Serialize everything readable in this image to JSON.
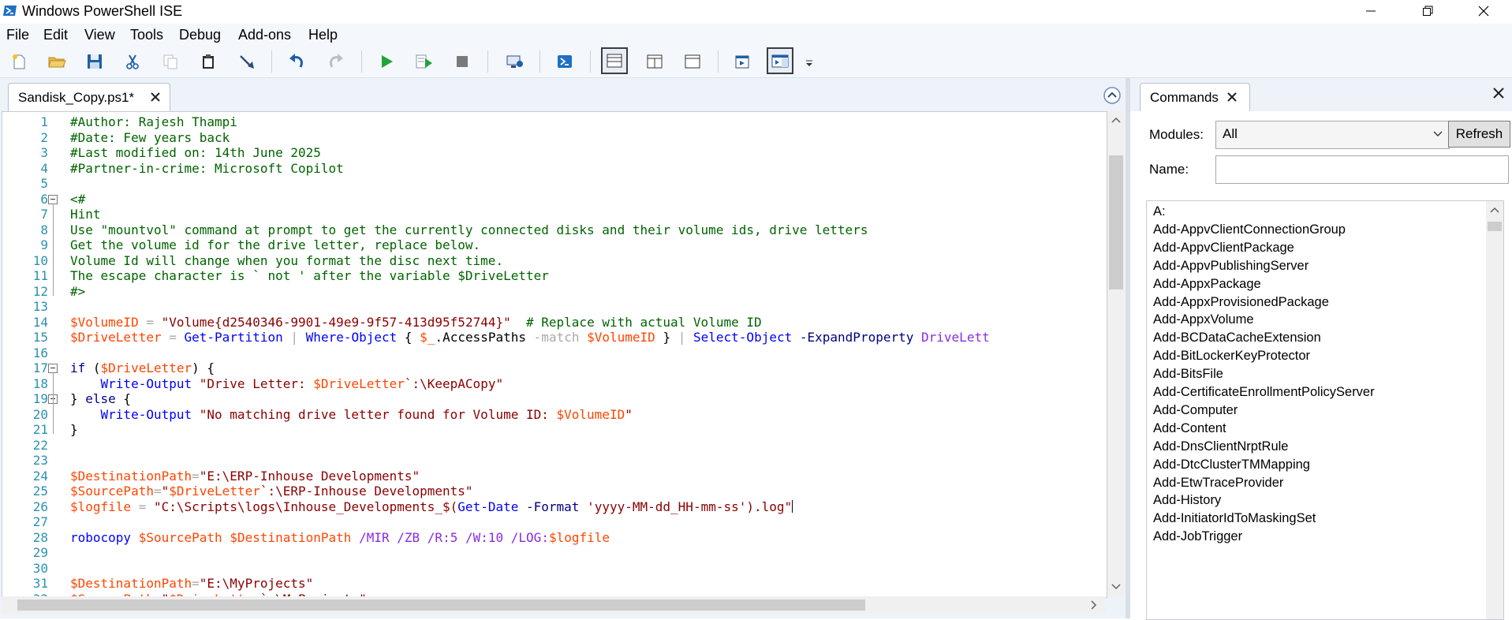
{
  "window": {
    "title": "Windows PowerShell ISE"
  },
  "menu": [
    "File",
    "Edit",
    "View",
    "Tools",
    "Debug",
    "Add-ons",
    "Help"
  ],
  "toolbar": {
    "buttons": [
      "new-script",
      "open",
      "save",
      "cut",
      "copy",
      "paste",
      "clear-console",
      "undo",
      "redo",
      "run-script",
      "run-selection",
      "stop",
      "new-remote-powershell-tab",
      "start-powershell-exe",
      "show-script-pane-top",
      "show-script-pane-right",
      "show-script-pane-maximized",
      "show-script-pane",
      "show-commands-addon",
      "toolbar-overflow"
    ]
  },
  "editor": {
    "tab_label": "Sandisk_Copy.ps1*",
    "lines": [
      [
        {
          "t": "#Author: Rajesh Thampi",
          "c": "com"
        }
      ],
      [
        {
          "t": "#Date: Few years back",
          "c": "com"
        }
      ],
      [
        {
          "t": "#Last modified on: 14th June 2025",
          "c": "com"
        }
      ],
      [
        {
          "t": "#Partner-in-crime: Microsoft Copilot",
          "c": "com"
        }
      ],
      [],
      [
        {
          "t": "<#",
          "c": "com"
        }
      ],
      [
        {
          "t": "Hint",
          "c": "com"
        }
      ],
      [
        {
          "t": "Use \"mountvol\" command at prompt to get the currently connected disks and their volume ids, drive letters",
          "c": "com"
        }
      ],
      [
        {
          "t": "Get the volume id for the drive letter, replace below.",
          "c": "com"
        }
      ],
      [
        {
          "t": "Volume Id will change when you format the disc next time.",
          "c": "com"
        }
      ],
      [
        {
          "t": "The escape character is ` not ' after the variable $DriveLetter",
          "c": "com"
        }
      ],
      [
        {
          "t": "#>",
          "c": "com"
        }
      ],
      [],
      [
        {
          "t": "$VolumeID",
          "c": "var"
        },
        {
          "t": " ",
          "c": "txt"
        },
        {
          "t": "=",
          "c": "op"
        },
        {
          "t": " ",
          "c": "txt"
        },
        {
          "t": "\"Volume{d2540346-9901-49e9-9f57-413d95f52744}\"",
          "c": "str"
        },
        {
          "t": "  ",
          "c": "txt"
        },
        {
          "t": "# Replace with actual Volume ID",
          "c": "com"
        }
      ],
      [
        {
          "t": "$DriveLetter",
          "c": "var"
        },
        {
          "t": " ",
          "c": "txt"
        },
        {
          "t": "=",
          "c": "op"
        },
        {
          "t": " ",
          "c": "txt"
        },
        {
          "t": "Get-Partition",
          "c": "cmd"
        },
        {
          "t": " ",
          "c": "txt"
        },
        {
          "t": "|",
          "c": "op"
        },
        {
          "t": " ",
          "c": "txt"
        },
        {
          "t": "Where-Object",
          "c": "cmd"
        },
        {
          "t": " { ",
          "c": "txt"
        },
        {
          "t": "$_",
          "c": "var"
        },
        {
          "t": ".AccessPaths ",
          "c": "mem"
        },
        {
          "t": "-match",
          "c": "op"
        },
        {
          "t": " ",
          "c": "txt"
        },
        {
          "t": "$VolumeID",
          "c": "var"
        },
        {
          "t": " } ",
          "c": "txt"
        },
        {
          "t": "|",
          "c": "op"
        },
        {
          "t": " ",
          "c": "txt"
        },
        {
          "t": "Select-Object",
          "c": "cmd"
        },
        {
          "t": " ",
          "c": "txt"
        },
        {
          "t": "-ExpandProperty",
          "c": "prm"
        },
        {
          "t": " ",
          "c": "txt"
        },
        {
          "t": "DriveLett",
          "c": "par"
        }
      ],
      [],
      [
        {
          "t": "if",
          "c": "kw"
        },
        {
          "t": " (",
          "c": "txt"
        },
        {
          "t": "$DriveLetter",
          "c": "var"
        },
        {
          "t": ") {",
          "c": "txt"
        }
      ],
      [
        {
          "t": "    ",
          "c": "txt"
        },
        {
          "t": "Write-Output",
          "c": "cmd"
        },
        {
          "t": " ",
          "c": "txt"
        },
        {
          "t": "\"Drive Letter: ",
          "c": "str"
        },
        {
          "t": "$DriveLetter",
          "c": "var"
        },
        {
          "t": "`:\\KeepACopy\"",
          "c": "str"
        }
      ],
      [
        {
          "t": "} ",
          "c": "txt"
        },
        {
          "t": "else",
          "c": "kw"
        },
        {
          "t": " {",
          "c": "txt"
        }
      ],
      [
        {
          "t": "    ",
          "c": "txt"
        },
        {
          "t": "Write-Output",
          "c": "cmd"
        },
        {
          "t": " ",
          "c": "txt"
        },
        {
          "t": "\"No matching drive letter found for Volume ID: ",
          "c": "str"
        },
        {
          "t": "$VolumeID",
          "c": "var"
        },
        {
          "t": "\"",
          "c": "str"
        }
      ],
      [
        {
          "t": "}",
          "c": "txt"
        }
      ],
      [],
      [],
      [
        {
          "t": "$DestinationPath",
          "c": "var"
        },
        {
          "t": "=",
          "c": "op"
        },
        {
          "t": "\"E:\\ERP-Inhouse Developments\"",
          "c": "str"
        }
      ],
      [
        {
          "t": "$SourcePath",
          "c": "var"
        },
        {
          "t": "=",
          "c": "op"
        },
        {
          "t": "\"",
          "c": "str"
        },
        {
          "t": "$DriveLetter",
          "c": "var"
        },
        {
          "t": "`:\\ERP-Inhouse Developments\"",
          "c": "str"
        }
      ],
      [
        {
          "t": "$logfile",
          "c": "var"
        },
        {
          "t": " ",
          "c": "txt"
        },
        {
          "t": "=",
          "c": "op"
        },
        {
          "t": " ",
          "c": "txt"
        },
        {
          "t": "\"C:\\Scripts\\logs\\Inhouse_Developments_$(",
          "c": "str"
        },
        {
          "t": "Get-Date",
          "c": "cmd"
        },
        {
          "t": " ",
          "c": "txt"
        },
        {
          "t": "-Format",
          "c": "prm"
        },
        {
          "t": " ",
          "c": "txt"
        },
        {
          "t": "'yyyy-MM-dd_HH-mm-ss'",
          "c": "str"
        },
        {
          "t": ").log\"",
          "c": "str"
        }
      ],
      [],
      [
        {
          "t": "robocopy",
          "c": "cmd"
        },
        {
          "t": " ",
          "c": "txt"
        },
        {
          "t": "$SourcePath",
          "c": "var"
        },
        {
          "t": " ",
          "c": "txt"
        },
        {
          "t": "$DestinationPath",
          "c": "var"
        },
        {
          "t": " ",
          "c": "txt"
        },
        {
          "t": "/MIR",
          "c": "par"
        },
        {
          "t": " ",
          "c": "txt"
        },
        {
          "t": "/ZB",
          "c": "par"
        },
        {
          "t": " ",
          "c": "txt"
        },
        {
          "t": "/R:5",
          "c": "par"
        },
        {
          "t": " ",
          "c": "txt"
        },
        {
          "t": "/W:10",
          "c": "par"
        },
        {
          "t": " ",
          "c": "txt"
        },
        {
          "t": "/LOG:",
          "c": "par"
        },
        {
          "t": "$logfile",
          "c": "var"
        }
      ],
      [],
      [],
      [
        {
          "t": "$DestinationPath",
          "c": "var"
        },
        {
          "t": "=",
          "c": "op"
        },
        {
          "t": "\"E:\\MyProjects\"",
          "c": "str"
        }
      ],
      [
        {
          "t": "$SourcePath",
          "c": "var"
        },
        {
          "t": "=",
          "c": "op"
        },
        {
          "t": "\"",
          "c": "str"
        },
        {
          "t": "$DriveLetter",
          "c": "var"
        },
        {
          "t": "`:\\MyProjects\"",
          "c": "str"
        }
      ]
    ],
    "caret_line": 26
  },
  "commands": {
    "tab_label": "Commands",
    "modules_label": "Modules:",
    "modules_value": "All",
    "refresh_label": "Refresh",
    "name_label": "Name:",
    "name_value": "",
    "items": [
      "A:",
      "Add-AppvClientConnectionGroup",
      "Add-AppvClientPackage",
      "Add-AppvPublishingServer",
      "Add-AppxPackage",
      "Add-AppxProvisionedPackage",
      "Add-AppxVolume",
      "Add-BCDataCacheExtension",
      "Add-BitLockerKeyProtector",
      "Add-BitsFile",
      "Add-CertificateEnrollmentPolicyServer",
      "Add-Computer",
      "Add-Content",
      "Add-DnsClientNrptRule",
      "Add-DtcClusterTMMapping",
      "Add-EtwTraceProvider",
      "Add-History",
      "Add-InitiatorIdToMaskingSet",
      "Add-JobTrigger"
    ]
  },
  "colors": {
    "comment": "#006400",
    "variable": "#ff4500",
    "string": "#8b0000",
    "command": "#0000ff",
    "keyword": "#00008b",
    "operator": "#a9a9a9",
    "argument": "#8a2be2",
    "line_number": "#2b91af"
  }
}
